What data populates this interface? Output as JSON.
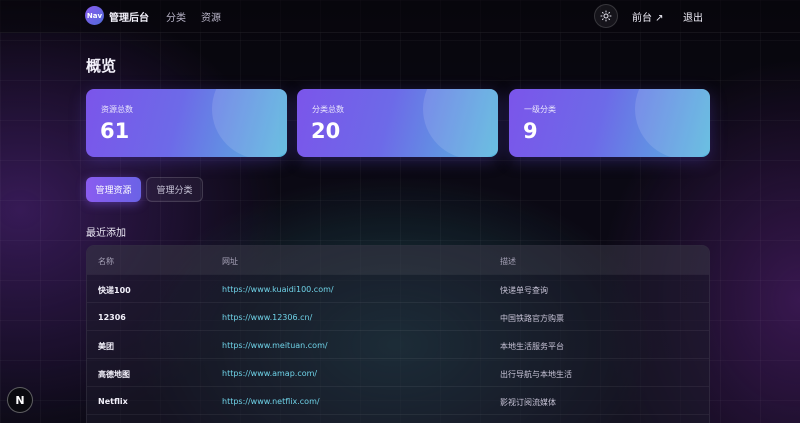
{
  "header": {
    "logo_text": "Nav",
    "brand": "管理后台",
    "nav": [
      {
        "label": "分类"
      },
      {
        "label": "资源"
      }
    ],
    "theme_icon": "sun-icon",
    "frontend_link": "前台 ↗",
    "logout": "退出"
  },
  "page_title": "概览",
  "stats": [
    {
      "label": "资源总数",
      "value": "61"
    },
    {
      "label": "分类总数",
      "value": "20"
    },
    {
      "label": "一级分类",
      "value": "9"
    }
  ],
  "tabs": [
    {
      "label": "管理资源",
      "active": true
    },
    {
      "label": "管理分类",
      "active": false
    }
  ],
  "recent": {
    "title": "最近添加",
    "columns": [
      "名称",
      "网址",
      "描述"
    ],
    "rows": [
      {
        "name": "快递100",
        "url": "https://www.kuaidi100.com/",
        "desc": "快递单号查询"
      },
      {
        "name": "12306",
        "url": "https://www.12306.cn/",
        "desc": "中国铁路官方购票"
      },
      {
        "name": "美团",
        "url": "https://www.meituan.com/",
        "desc": "本地生活服务平台"
      },
      {
        "name": "高德地图",
        "url": "https://www.amap.com/",
        "desc": "出行导航与本地生活"
      },
      {
        "name": "Netflix",
        "url": "https://www.netflix.com/",
        "desc": "影视订阅流媒体"
      }
    ]
  },
  "corner_badge": "N",
  "colors": {
    "accent_purple": "#8a5cf0",
    "accent_cyan": "#56b8de",
    "link_cyan": "#6fd3e8"
  }
}
